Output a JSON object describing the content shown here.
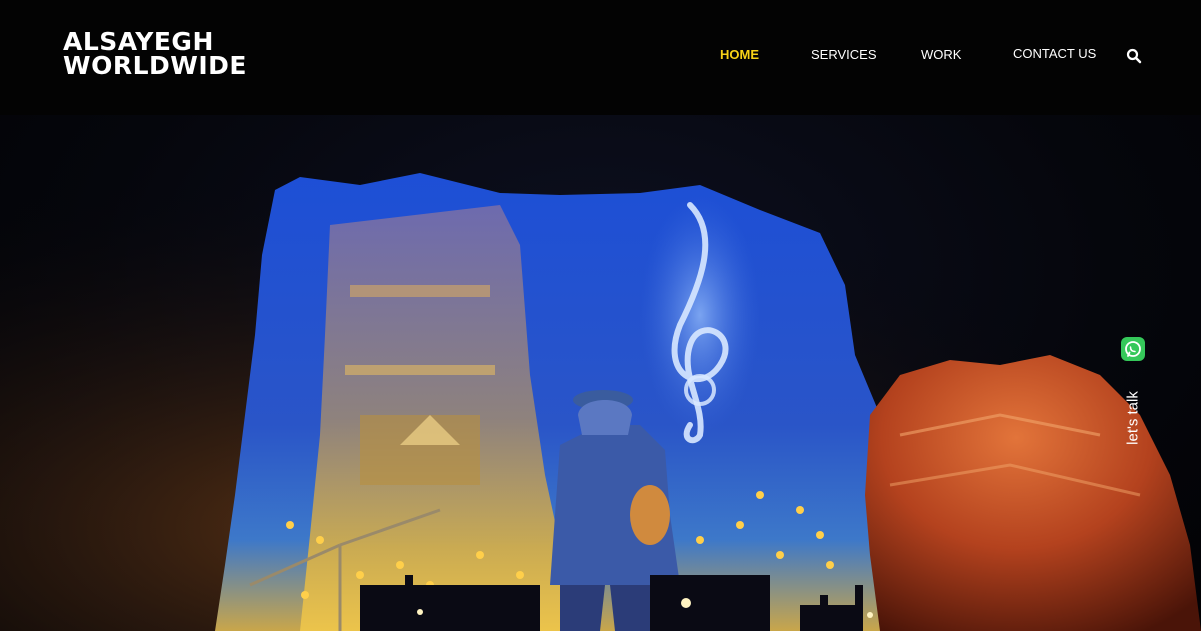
{
  "brand": {
    "line1": "ALSAYEGH",
    "line2": "WORLDWIDE"
  },
  "nav": {
    "items": [
      {
        "label": "HOME",
        "active": true
      },
      {
        "label": "SERVICES",
        "active": false
      },
      {
        "label": "WORK",
        "active": false
      },
      {
        "label": "CONTACT US",
        "active": false
      }
    ]
  },
  "icons": {
    "search": "search-icon",
    "whatsapp": "whatsapp-icon"
  },
  "side": {
    "lets_talk": "let's talk"
  },
  "colors": {
    "active_nav": "#f7d217",
    "header_bg": "#030303",
    "whatsapp": "#35c85a"
  }
}
